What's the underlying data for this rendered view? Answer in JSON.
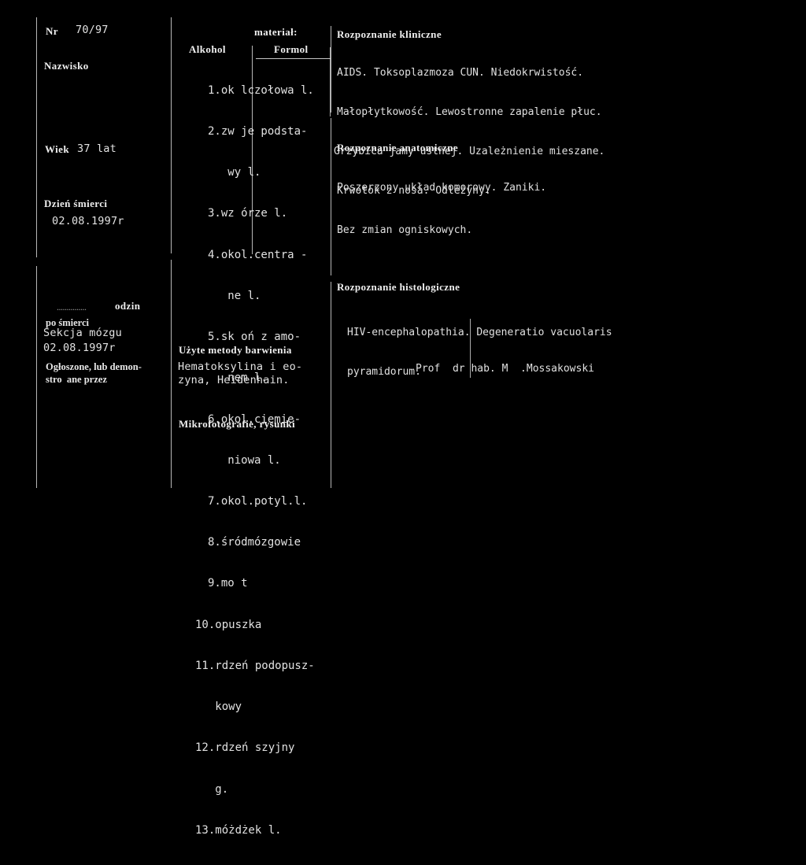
{
  "document": {
    "type": "autopsy-record-card",
    "language": "pl"
  },
  "left_column": {
    "nr_label": "Nr",
    "nr_value": "70/97",
    "surname_label": "Nazwisko",
    "surname_value": "",
    "age_label": "Wiek",
    "age_value": "37 lat",
    "death_day_label": "Dzień śmierci",
    "death_day_value": "02.08.1997r",
    "hours_dots": "...............",
    "hours_label": "odzin",
    "after_death_label": "po śmierci",
    "brain_section_label": "Sekcja mózgu",
    "brain_section_date": "02.08.1997r",
    "announced_label_line1": "Ogłoszone, lub demon-",
    "announced_label_line2": "stro  ane przez"
  },
  "middle_column": {
    "material_label": "materiał:",
    "alcohol_label": "Alkohol",
    "formol_label": "Formol",
    "organ_items": [
      "1.ok lczołowa l.",
      "2.zw je podsta-",
      "   wy l.",
      "3.wz órze l.",
      "4.okol.centra -",
      "   ne l.",
      "5.sk oń z amo-",
      "   nem l.",
      "6.okol.ciemie-",
      "   niowa l.",
      "7.okol.potyl.l.",
      "8.śródmózgowie",
      "9.mo t",
      "10.opuszka",
      "11.rdzeń podopusz-",
      "   kowy",
      "12.rdzeń szyjny",
      "   g.",
      "13.móżdżek l."
    ],
    "staining_label": "Użyte metody barwienia",
    "staining_line1": "Hematoksylina i eo-",
    "staining_line2": "zyna, Heidenhain.",
    "microphoto_label": "Mikrofotografie, rysunki"
  },
  "right_column": {
    "clinical_label": "Rozpoznanie kliniczne",
    "clinical_lines": [
      "AIDS. Toksoplazmoza CUN. Niedokrwistość.",
      "Małopłytkowość. Lewostronne zapalenie płuc.",
      "Grzybica jamy ustnej. Uzależnienie mieszane.",
      "Krwotok z nosa. Odleżyny."
    ],
    "anatomical_label": "Rozpoznanie anatomiczne",
    "anatomical_lines": [
      "Poszerzony układ komorowy. Zaniki.",
      "Bez zmian ogniskowych."
    ],
    "histological_label": "Rozpoznanie histologiczne",
    "histological_lines": [
      "HIV-encephalopathia. Degeneratio vacuolaris",
      "pyramidorum."
    ],
    "signature": "Prof  dr hab. M  .Mossakowski"
  },
  "colors": {
    "background": "#000000",
    "text": "#e4e4e4",
    "rule": "#d8d8d8"
  }
}
